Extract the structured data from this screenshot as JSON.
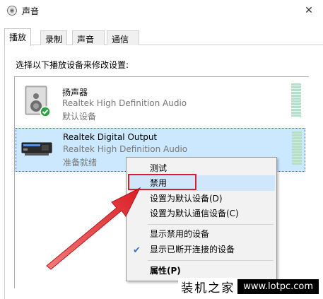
{
  "window": {
    "title": "声音",
    "close_glyph": "✕"
  },
  "tabs": [
    {
      "label": "播放",
      "active": true
    },
    {
      "label": "录制",
      "active": false
    },
    {
      "label": "声音",
      "active": false
    },
    {
      "label": "通信",
      "active": false
    }
  ],
  "instruction": "选择以下播放设备来修改设置:",
  "devices": [
    {
      "name": "扬声器",
      "driver": "Realtek High Definition Audio",
      "status": "默认设备",
      "icon": "speaker-icon",
      "selected": false
    },
    {
      "name": "Realtek Digital Output",
      "driver": "Realtek High Definition Audio",
      "status": "准备就绪",
      "icon": "digital-output-icon",
      "selected": true
    }
  ],
  "context_menu": {
    "items": [
      {
        "label": "测试"
      },
      {
        "label": "禁用",
        "highlighted": true
      },
      {
        "label": "设置为默认设备(D)"
      },
      {
        "label": "设置为默认通信设备(C)"
      },
      {
        "label": "显示禁用的设备"
      },
      {
        "label": "显示已断开连接的设备",
        "checked": true
      },
      {
        "label": "属性(P)",
        "bold": true
      }
    ],
    "check_glyph": "✔"
  },
  "watermark": {
    "text": "装机之家",
    "url": "www.lotpc.com"
  },
  "colors": {
    "selection": "#cce8ff",
    "menu_highlight": "#cfe6fb",
    "annotation_red": "#d1232d",
    "check_blue": "#3b6fc1"
  }
}
